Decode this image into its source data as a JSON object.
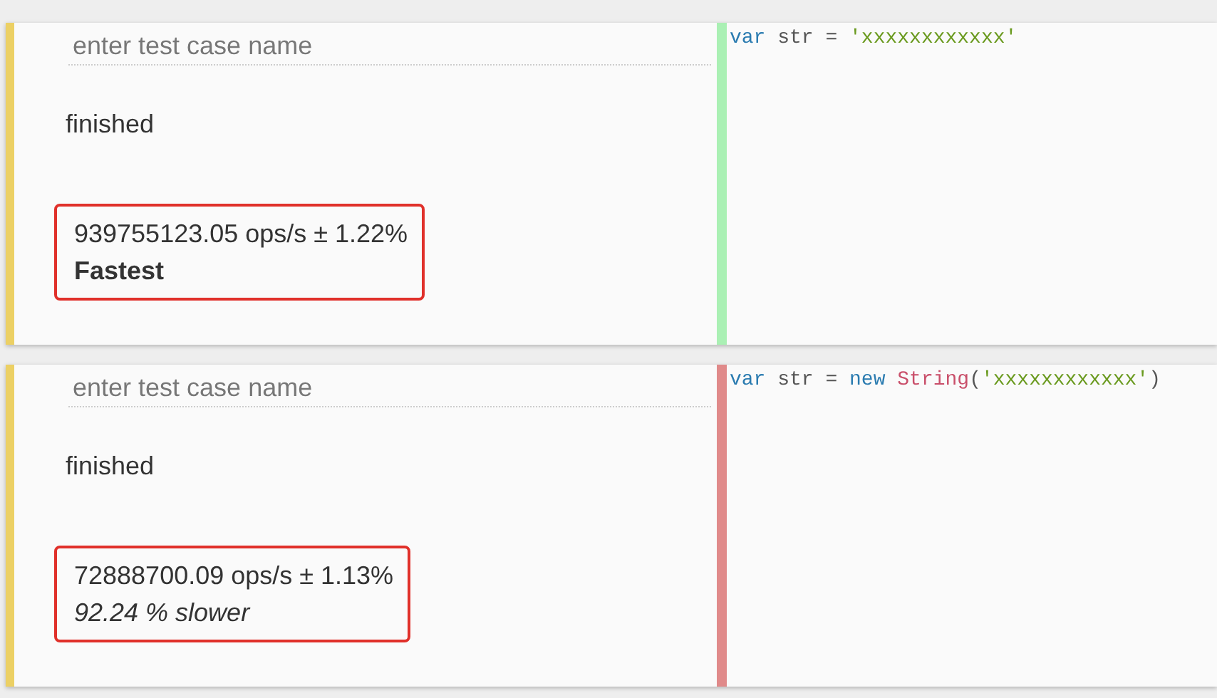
{
  "cases": [
    {
      "name_placeholder": "enter test case name",
      "status": "finished",
      "result": {
        "ops": "939755123.05 ops/s ± 1.22%",
        "verdict": "Fastest",
        "kind": "fastest",
        "highlighted": true
      },
      "code": [
        {
          "kind": "keyword",
          "text": "var"
        },
        {
          "kind": "plain",
          "text": " str = "
        },
        {
          "kind": "string",
          "text": "'xxxxxxxxxxxx'"
        }
      ]
    },
    {
      "name_placeholder": "enter test case name",
      "status": "finished",
      "result": {
        "ops": "72888700.09 ops/s ± 1.13%",
        "verdict": "92.24 % slower",
        "kind": "slower",
        "highlighted": true
      },
      "code": [
        {
          "kind": "keyword",
          "text": "var"
        },
        {
          "kind": "plain",
          "text": " str = "
        },
        {
          "kind": "keyword",
          "text": "new "
        },
        {
          "kind": "builtin",
          "text": "String"
        },
        {
          "kind": "plain",
          "text": "("
        },
        {
          "kind": "string",
          "text": "'xxxxxxxxxxxx'"
        },
        {
          "kind": "plain",
          "text": ")"
        }
      ]
    }
  ]
}
